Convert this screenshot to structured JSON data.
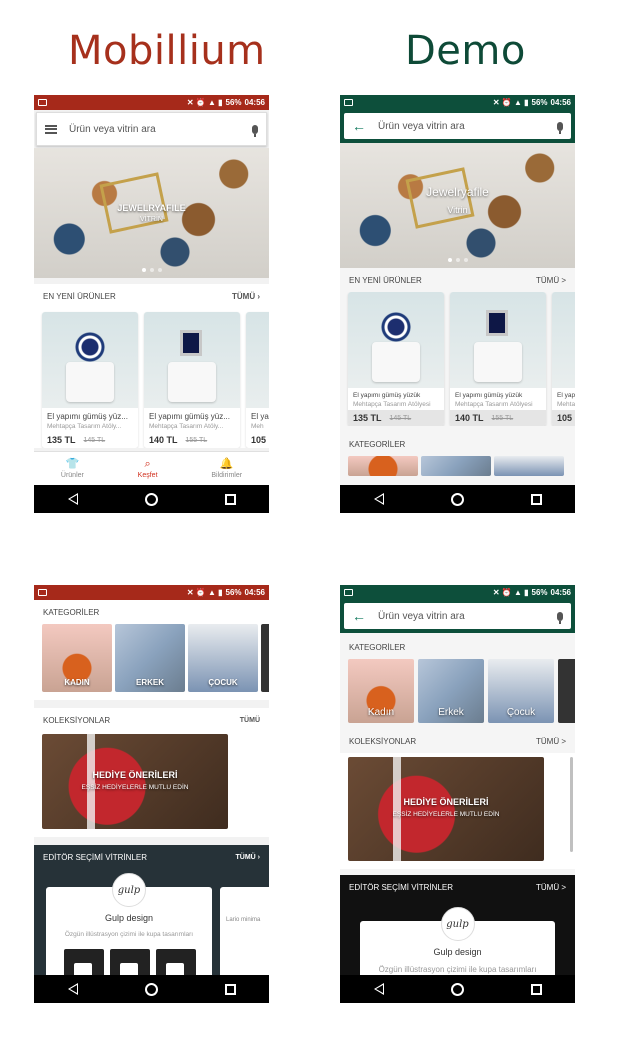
{
  "headings": {
    "left": "Mobillium",
    "right": "Demo"
  },
  "colors": {
    "brand_red": "#a6291a",
    "brand_green": "#0d4f3b",
    "accent_red": "#d1311f",
    "heading_red": "#a6301c",
    "heading_green": "#0e4a37"
  },
  "status": {
    "battery": "56%",
    "time": "04:56"
  },
  "search": {
    "placeholder": "Ürün veya vitrin ara"
  },
  "hero": {
    "title_mobillium": "JEWELRYAFILE",
    "sub_mobillium": "VİTRİN",
    "title_demo": "Jewelryafile",
    "sub_demo": "Vitrin"
  },
  "sections": {
    "new_products_upper": "EN YENİ ÜRÜNLER",
    "new_products_demo": "EN YENİ ÜRÜNLER",
    "all_upper": "TÜMÜ",
    "all_demo": "TÜMÜ",
    "categories": "KATEGORİLER",
    "collections": "KOLEKSİYONLAR",
    "editor": "EDİTÖR SEÇİMİ VİTRİNLER"
  },
  "products_mobillium": [
    {
      "name": "El yapımı gümüş yüz...",
      "shop": "Mehtapça Tasarım Atöly...",
      "price": "135 TL",
      "old": "145 TL"
    },
    {
      "name": "El yapımı gümüş yüz...",
      "shop": "Mehtapça Tasarım Atöly...",
      "price": "140 TL",
      "old": "155 TL"
    },
    {
      "name": "El ya",
      "shop": "Meh",
      "price": "105",
      "old": ""
    }
  ],
  "products_demo": [
    {
      "name": "El yapımı gümüş yüzük",
      "shop": "Mehtapça Tasarım Atölyesi",
      "price": "135 TL",
      "old": "145 TL"
    },
    {
      "name": "El yapımı gümüş yüzük",
      "shop": "Mehtapça Tasarım Atölyesi",
      "price": "140 TL",
      "old": "155 TL"
    },
    {
      "name": "El yapır",
      "shop": "Mehtap",
      "price": "105",
      "old": ""
    }
  ],
  "nav": {
    "products": "Ürünler",
    "explore": "Keşfet",
    "notifications": "Bildirimler"
  },
  "categories": {
    "women": "KADIN",
    "men": "ERKEK",
    "kids": "ÇOCUK",
    "women_demo": "Kadın",
    "men_demo": "Erkek",
    "kids_demo": "Çocuk"
  },
  "collection": {
    "title": "HEDİYE ÖNERİLERİ",
    "sub": "EŞSİZ HEDİYELERLE MUTLU EDİN"
  },
  "editor": {
    "logo": "gulp",
    "name": "Gulp design",
    "desc": "Özgün illüstrasyon çizimi ile kupa tasarımları",
    "side_text": "Lario minima"
  }
}
